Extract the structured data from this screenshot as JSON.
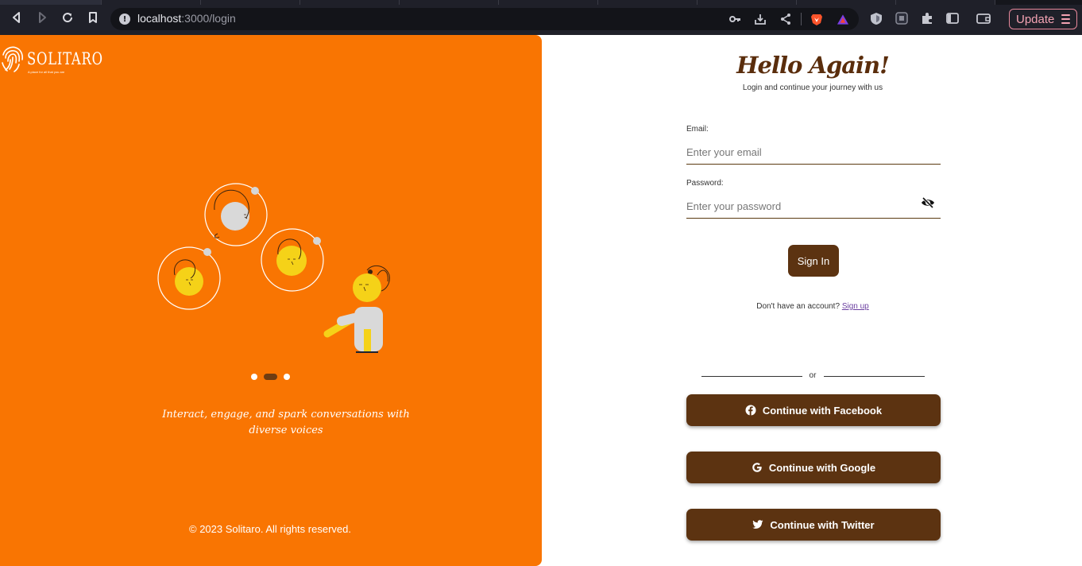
{
  "browser": {
    "url_host": "localhost",
    "url_path": ":3000/login",
    "update_label": "Update"
  },
  "left_panel": {
    "brand": "SOLITARO",
    "brand_tagline": "A place for all that you are",
    "caption": "Interact, engage, and spark conversations with diverse voices",
    "carousel": {
      "total": 3,
      "active": 2
    },
    "footer": "© 2023 Solitaro. All rights reserved."
  },
  "login": {
    "title": "Hello Again!",
    "subtitle": "Login and continue your journey with us",
    "email_label": "Email:",
    "email_placeholder": "Enter your email",
    "password_label": "Password:",
    "password_placeholder": "Enter your password",
    "signin_label": "Sign In",
    "no_account_text": "Don't have an account?",
    "signup_link": "Sign up",
    "or_text": "or",
    "facebook_label": "Continue with Facebook",
    "google_label": "Continue with Google",
    "twitter_label": "Continue with Twitter"
  },
  "colors": {
    "panel_orange": "#f97502",
    "button_brown": "#5c3311",
    "title_brown": "#5a2d0c"
  }
}
